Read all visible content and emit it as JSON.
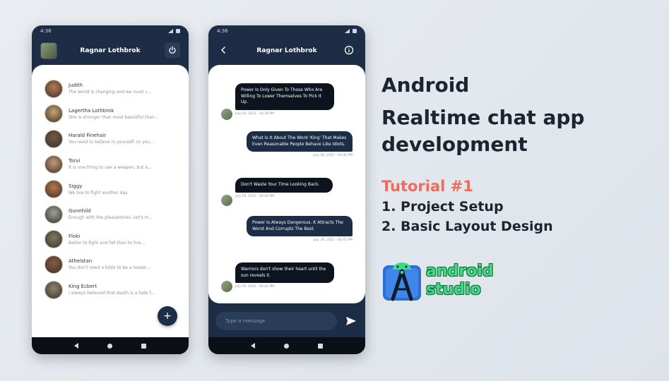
{
  "colors": {
    "navy": "#1c2d45",
    "tutorial": "#ef6b5a",
    "android_green": "#3ddc84"
  },
  "phone_users": {
    "status_time": "4:36",
    "title": "Ragnar Lothbrok",
    "icons": {
      "avatar": "user-avatar-square",
      "logout": "power-icon",
      "fab": "plus-icon"
    },
    "fab_label": "+",
    "users": [
      {
        "name": "Judith",
        "message": "The world is changing and we must c...",
        "avatar_color": "#b57a55"
      },
      {
        "name": "Lagertha Lothbrok",
        "message": "She is stronger than most beautiful than...",
        "avatar_color": "#c9a46d"
      },
      {
        "name": "Harald Finehair",
        "message": "You need to believe in yourself, or you...",
        "avatar_color": "#6f5a47"
      },
      {
        "name": "Torvi",
        "message": "It is one thing to use a weapon, but a...",
        "avatar_color": "#c79a78"
      },
      {
        "name": "Siggy",
        "message": "We live to fight another day",
        "avatar_color": "#b8784f"
      },
      {
        "name": "Gunnhild",
        "message": "Enough with the pleasantries. Let's m...",
        "avatar_color": "#9aa59a"
      },
      {
        "name": "Floki",
        "message": "Better to fight and fall than to live...",
        "avatar_color": "#7c7a60"
      },
      {
        "name": "Athelstan",
        "message": "You don't need a bible to be a healer...",
        "avatar_color": "#8a5a45"
      },
      {
        "name": "King Ecbert",
        "message": "I always believed that death is a fade f...",
        "avatar_color": "#8d8473"
      }
    ]
  },
  "phone_chat": {
    "status_time": "4:36",
    "title": "Ragnar Lothbrok",
    "icons": {
      "back": "back-arrow-icon",
      "info": "info-icon",
      "send": "send-icon"
    },
    "messages": [
      {
        "direction": "received",
        "text": "Power Is Only Given To Those Who Are Willing To Lower Themselves To Pick It Up.",
        "time": "July 29, 2021 - 04:39 PM"
      },
      {
        "direction": "sent",
        "text": "What Is It About The Word 'King' That Makes Even Reasonable People Behave Like Idiots.",
        "time": "July 29, 2021 - 04:40 PM"
      },
      {
        "direction": "received",
        "text": "Don't Waste Your Time Looking Back.",
        "time": "July 29, 2021 - 04:40 PM"
      },
      {
        "direction": "sent",
        "text": "Power Is Always Dangerous. It Attracts The Worst And Corrupts The Best.",
        "time": "July 29, 2021 - 04:41 PM"
      },
      {
        "direction": "received",
        "text": "Warriors don't show their heart until the sun reveals it.",
        "time": "July 29, 2021 - 04:41 PM"
      }
    ],
    "input_placeholder": "Type a message"
  },
  "headline": {
    "line1": "Android",
    "line2": "Realtime chat app",
    "line3": "development",
    "tutorial": "Tutorial #1",
    "item1": "1. Project Setup",
    "item2": "2. Basic Layout Design"
  },
  "logo": {
    "icon": "android-studio-logo-icon",
    "line1": "android",
    "line2": "studio"
  }
}
